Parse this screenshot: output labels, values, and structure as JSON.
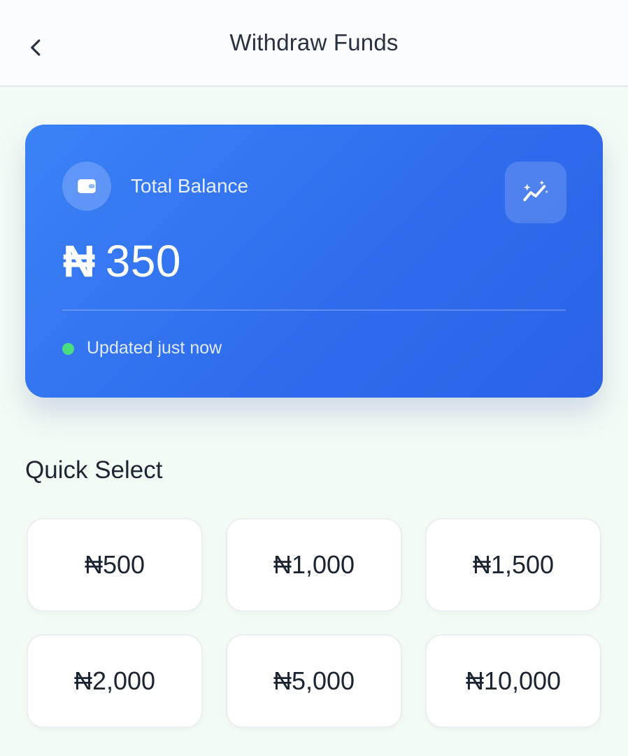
{
  "header": {
    "title": "Withdraw Funds",
    "back_icon": "chevron-left-icon"
  },
  "balance_card": {
    "label": "Total Balance",
    "currency": "₦",
    "amount": "350",
    "status": "Updated just now",
    "wallet_icon": "wallet-icon",
    "trend_icon": "sparkle-trend-icon",
    "colors": {
      "gradient_start": "#3b82f6",
      "gradient_end": "#2b63e6",
      "status_dot": "#4ade80"
    }
  },
  "quick_select": {
    "title": "Quick Select",
    "options": [
      "₦500",
      "₦1,000",
      "₦1,500",
      "₦2,000",
      "₦5,000",
      "₦10,000"
    ]
  }
}
